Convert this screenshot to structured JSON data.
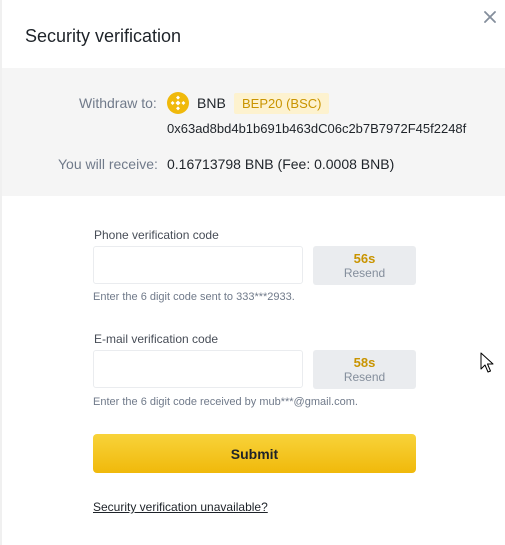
{
  "dialog": {
    "title": "Security verification",
    "close_icon": "close-icon"
  },
  "withdraw": {
    "to_label": "Withdraw to:",
    "coin_icon": "bnb-coin-icon",
    "coin": "BNB",
    "network": "BEP20 (BSC)",
    "address": "0x63ad8bd4b1b691b463dC06c2b7B7972F45f2248f",
    "receive_label": "You will receive:",
    "receive_value": "0.16713798 BNB (Fee: 0.0008 BNB)"
  },
  "phone": {
    "label": "Phone verification code",
    "value": "",
    "countdown": "56s",
    "resend_label": "Resend",
    "hint": "Enter the 6 digit code sent to 333***2933."
  },
  "email": {
    "label": "E-mail verification code",
    "value": "",
    "countdown": "58s",
    "resend_label": "Resend",
    "hint": "Enter the 6 digit code received by mub***@gmail.com."
  },
  "actions": {
    "submit_label": "Submit",
    "unavailable_link": "Security verification unavailable?"
  },
  "colors": {
    "accent": "#F0B90B",
    "badge_bg": "#FDF2CF",
    "badge_text": "#C99400",
    "panel_bg": "#F5F5F5"
  },
  "pointer_icon": "mouse-pointer-icon"
}
